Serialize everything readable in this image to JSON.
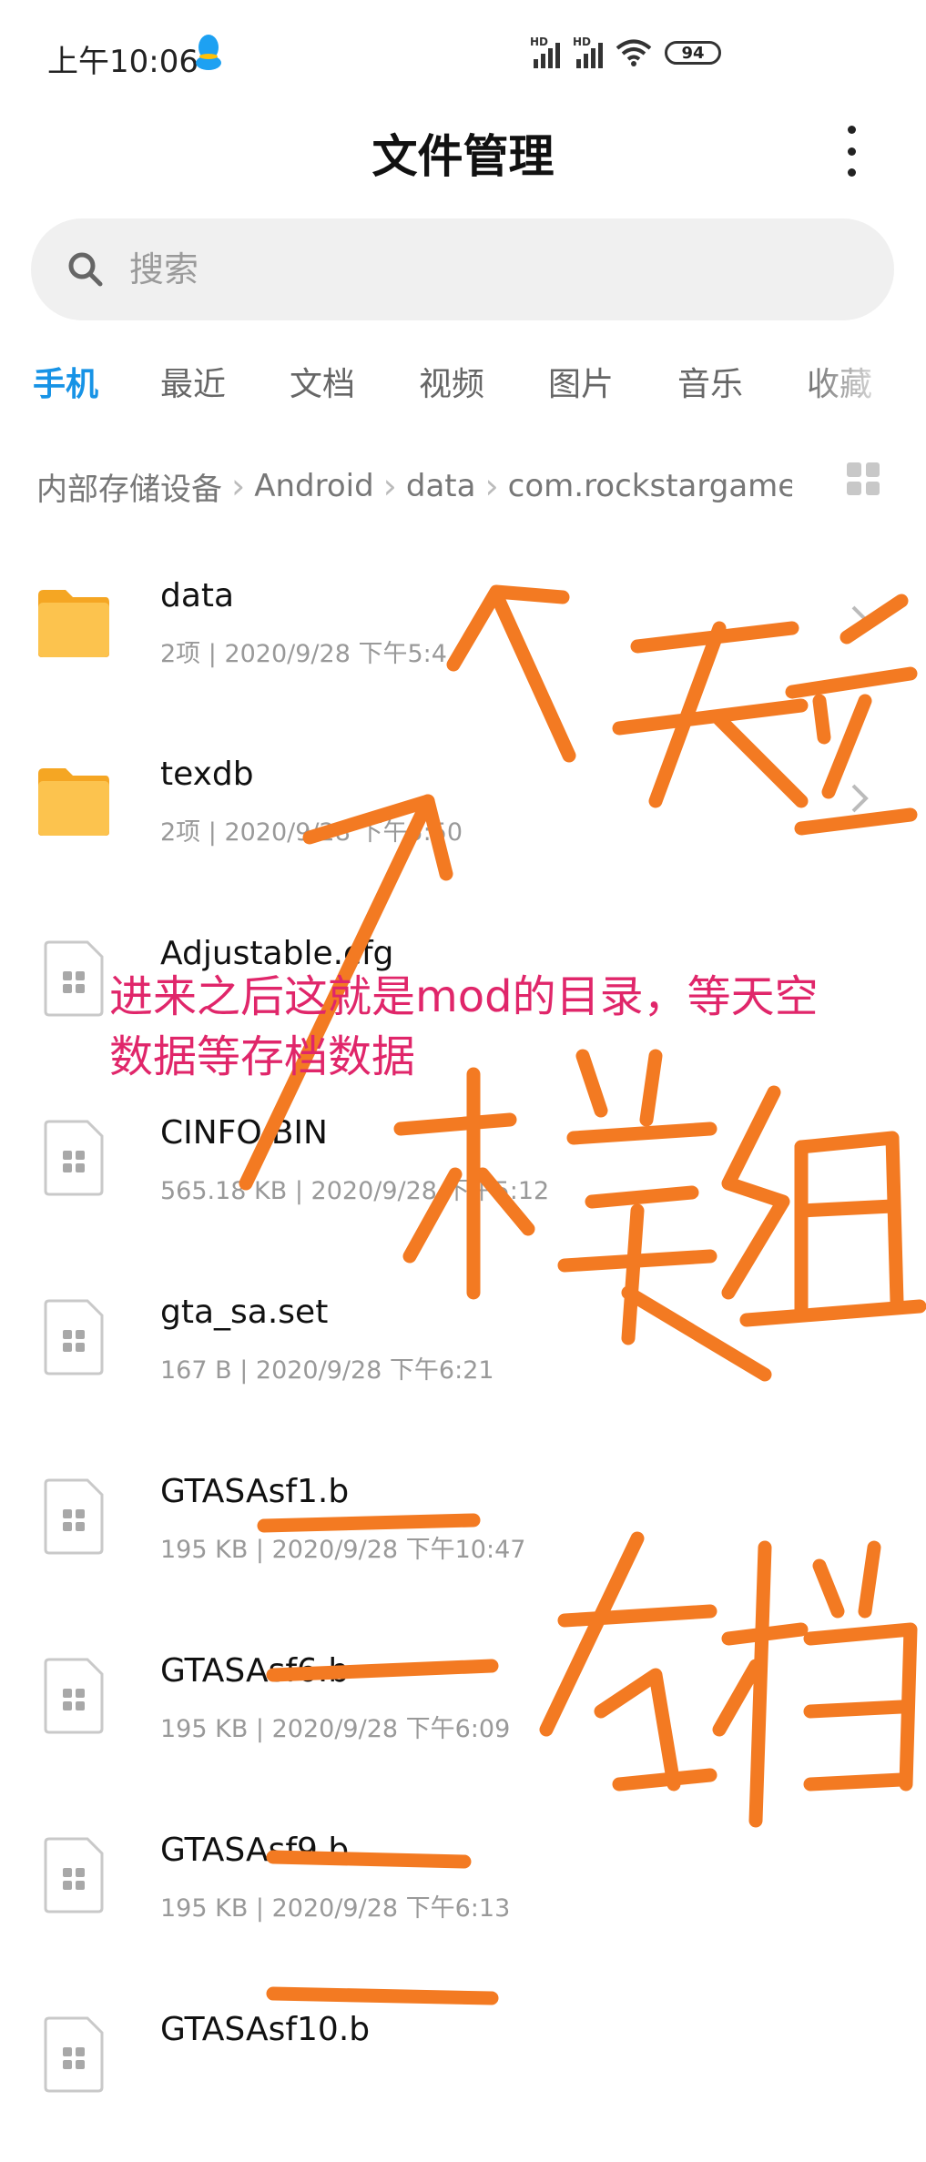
{
  "status_bar": {
    "time": "上午10:06",
    "battery": "94",
    "hd1": "HD",
    "hd2": "HD"
  },
  "header": {
    "title": "文件管理"
  },
  "search": {
    "placeholder": "搜索"
  },
  "tabs": [
    "手机",
    "最近",
    "文档",
    "视频",
    "图片",
    "音乐",
    "收藏"
  ],
  "active_tab": "手机",
  "breadcrumb": [
    "内部存储设备",
    "Android",
    "data",
    "com.rockstargames"
  ],
  "files": [
    {
      "name": "data",
      "meta": "2项 | 2020/9/28 下午5:4",
      "type": "folder"
    },
    {
      "name": "texdb",
      "meta": "2项 | 2020/9/28 下午5:50",
      "type": "folder"
    },
    {
      "name": "Adjustable.cfg",
      "meta": "",
      "type": "file"
    },
    {
      "name": "CINFO.BIN",
      "meta": "565.18 KB | 2020/9/28 下午5:12",
      "type": "file"
    },
    {
      "name": "gta_sa.set",
      "meta": "167 B | 2020/9/28 下午6:21",
      "type": "file"
    },
    {
      "name": "GTASAsf1.b",
      "meta": "195 KB | 2020/9/28 下午10:47",
      "type": "file"
    },
    {
      "name": "GTASAsf6.b",
      "meta": "195 KB | 2020/9/28 下午6:09",
      "type": "file"
    },
    {
      "name": "GTASAsf9.b",
      "meta": "195 KB | 2020/9/28 下午6:13",
      "type": "file"
    },
    {
      "name": "GTASAsf10.b",
      "meta": "",
      "type": "file"
    }
  ],
  "annotation": {
    "note": "进来之后这就是mod的目录，等天空数据等存档数据"
  },
  "colors": {
    "accent": "#1793e6",
    "folder": "#fcc34e",
    "scrawl": "#f37a22",
    "note": "#e0266a"
  },
  "icons": {
    "search": "search-icon",
    "more": "more-vertical-icon",
    "view": "grid-view-icon",
    "folder": "folder-icon",
    "file": "file-icon",
    "chevron": "chevron-right-icon"
  }
}
